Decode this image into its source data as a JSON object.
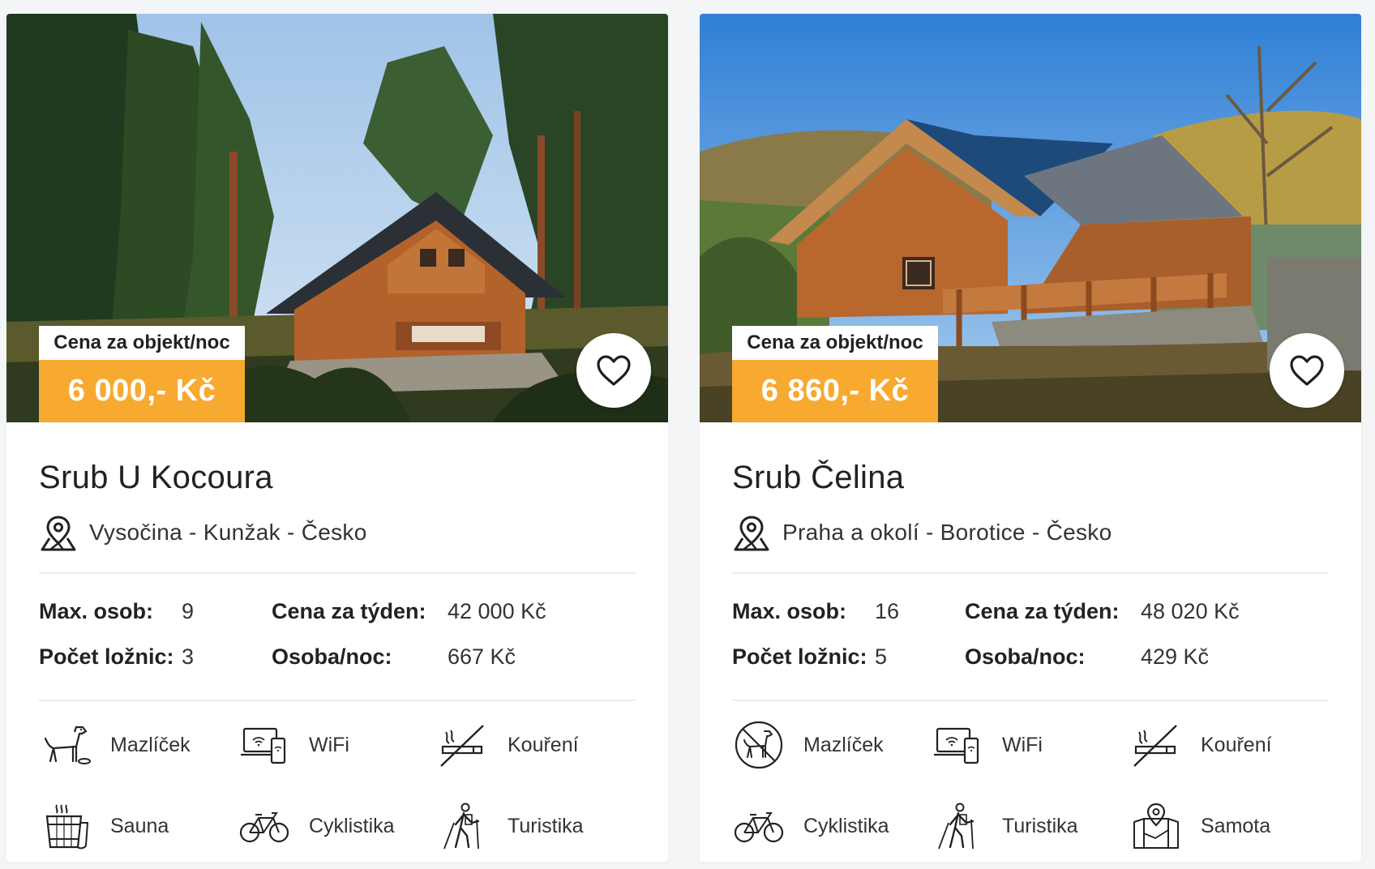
{
  "cards": [
    {
      "price_label": "Cena za objekt/noc",
      "price": "6 000,- Kč",
      "title": "Srub U Kocoura",
      "location": "Vysočina - Kunžak - Česko",
      "stats": {
        "max_persons_label": "Max. osob:",
        "max_persons": "9",
        "bedrooms_label": "Počet ložnic:",
        "bedrooms": "3",
        "week_price_label": "Cena za týden:",
        "week_price": "42 000 Kč",
        "person_night_label": "Osoba/noc:",
        "person_night": "667 Kč"
      },
      "amenities": [
        {
          "label": "Mazlíček",
          "icon": "dog-icon"
        },
        {
          "label": "WiFi",
          "icon": "wifi-devices-icon"
        },
        {
          "label": "Kouření",
          "icon": "no-smoking-icon"
        },
        {
          "label": "Sauna",
          "icon": "sauna-bucket-icon"
        },
        {
          "label": "Cyklistika",
          "icon": "bicycle-icon"
        },
        {
          "label": "Turistika",
          "icon": "hiker-icon"
        }
      ]
    },
    {
      "price_label": "Cena za objekt/noc",
      "price": "6 860,- Kč",
      "title": "Srub Čelina",
      "location": "Praha a okolí - Borotice - Česko",
      "stats": {
        "max_persons_label": "Max. osob:",
        "max_persons": "16",
        "bedrooms_label": "Počet ložnic:",
        "bedrooms": "5",
        "week_price_label": "Cena za týden:",
        "week_price": "48 020 Kč",
        "person_night_label": "Osoba/noc:",
        "person_night": "429 Kč"
      },
      "amenities": [
        {
          "label": "Mazlíček",
          "icon": "no-pets-icon"
        },
        {
          "label": "WiFi",
          "icon": "wifi-devices-icon"
        },
        {
          "label": "Kouření",
          "icon": "no-smoking-icon"
        },
        {
          "label": "Cyklistika",
          "icon": "bicycle-icon"
        },
        {
          "label": "Turistika",
          "icon": "hiker-icon"
        },
        {
          "label": "Samota",
          "icon": "map-pin-icon"
        }
      ]
    }
  ],
  "colors": {
    "accent": "#f7a930",
    "background": "#f4f5f6",
    "card": "#ffffff",
    "text": "#222222"
  }
}
